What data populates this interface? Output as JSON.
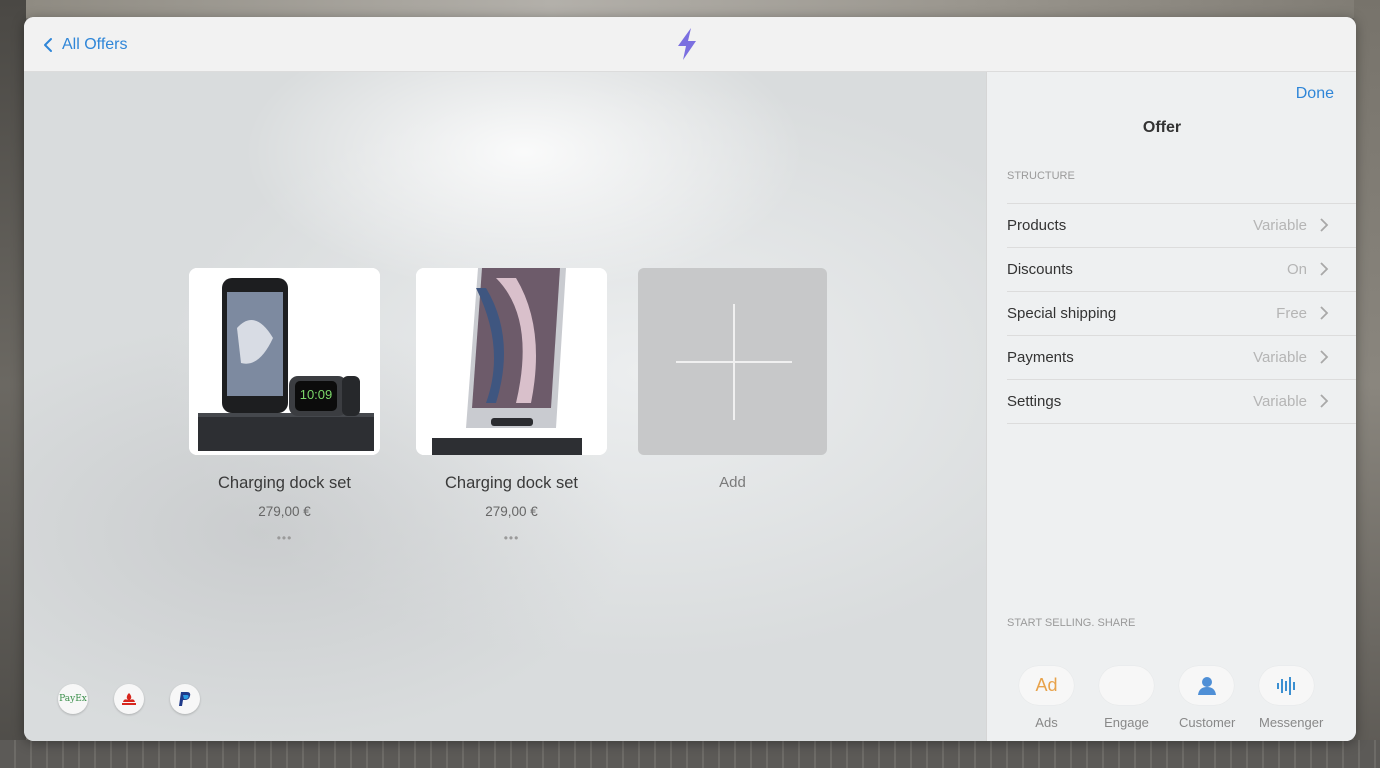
{
  "header": {
    "back_label": "All Offers"
  },
  "products": [
    {
      "title": "Charging dock set",
      "price": "279,00 €",
      "more": "•••"
    },
    {
      "title": "Charging dock set",
      "price": "279,00 €",
      "more": "•••"
    }
  ],
  "add_tile": {
    "label": "Add"
  },
  "payment_methods": [
    "PayEx",
    "Santander",
    "PayPal"
  ],
  "panel": {
    "done_label": "Done",
    "title": "Offer",
    "structure_label": "STRUCTURE",
    "rows": [
      {
        "name": "Products",
        "value": "Variable"
      },
      {
        "name": "Discounts",
        "value": "On"
      },
      {
        "name": "Special shipping",
        "value": "Free"
      },
      {
        "name": "Payments",
        "value": "Variable"
      },
      {
        "name": "Settings",
        "value": "Variable"
      }
    ],
    "share_label": "START SELLING. SHARE",
    "share_items": [
      {
        "label": "Ads",
        "icon_text": "Ad"
      },
      {
        "label": "Engage",
        "icon_text": ""
      },
      {
        "label": "Customer",
        "icon_text": ""
      },
      {
        "label": "Messenger",
        "icon_text": ""
      }
    ]
  },
  "colors": {
    "accent": "#2f86d8",
    "logo": "#7b6fe0",
    "ads_orange": "#e8a24a"
  }
}
